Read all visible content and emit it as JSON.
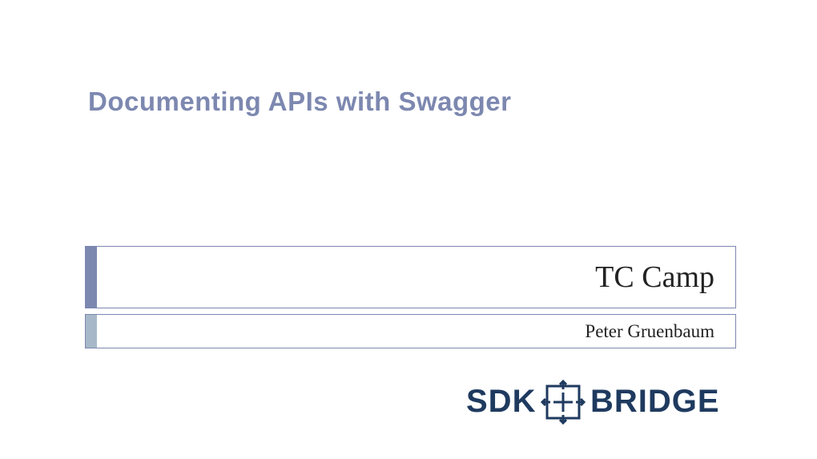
{
  "slide": {
    "title": "Documenting APIs with Swagger",
    "main_heading": "TC Camp",
    "subtitle": "Peter Gruenbaum",
    "logo_text_1": "SDK",
    "logo_text_2": "BRIDGE"
  },
  "colors": {
    "accent_primary": "#7d88b0",
    "accent_secondary": "#a7b9c8",
    "logo_color": "#1f3a5f"
  }
}
